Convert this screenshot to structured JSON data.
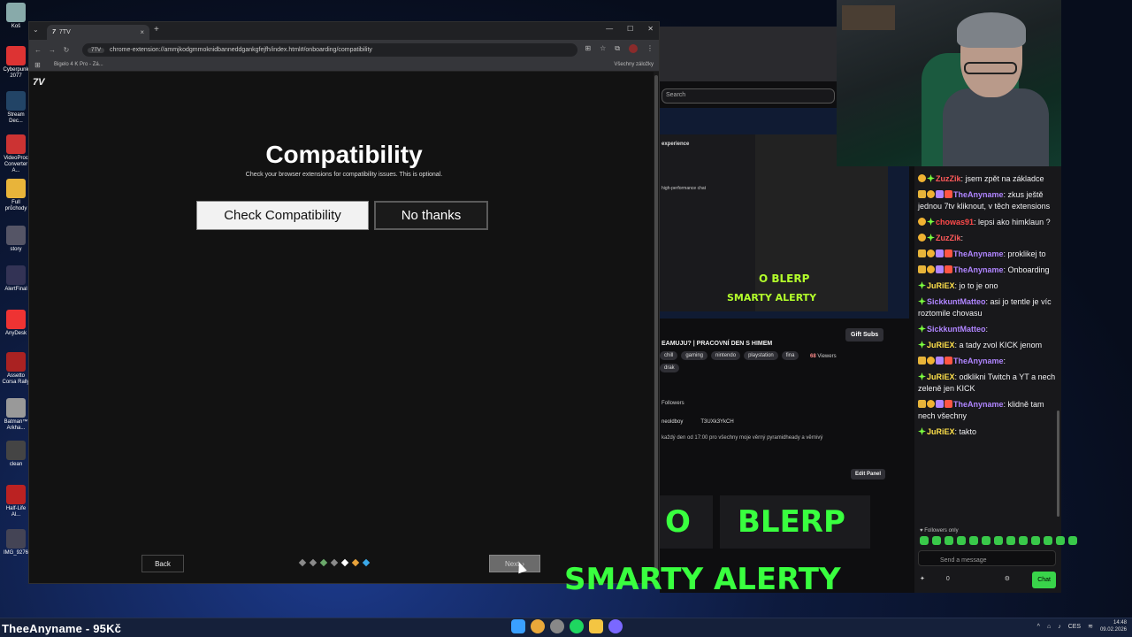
{
  "desktop": {
    "icons": [
      {
        "label": "Koš"
      },
      {
        "label": "Cyberpunk 2077"
      },
      {
        "label": "Stream Dec..."
      },
      {
        "label": "VideoProc Converter A..."
      },
      {
        "label": "Full průchody"
      },
      {
        "label": "story"
      },
      {
        "label": "AlertFinal"
      },
      {
        "label": "AnyDesk"
      },
      {
        "label": "Assetto Corsa Rally"
      },
      {
        "label": "Batman™ Arkha..."
      },
      {
        "label": "clean"
      },
      {
        "label": "Half-Life Al..."
      },
      {
        "label": "IMG_9276"
      }
    ]
  },
  "browser": {
    "tab_title": "7TV",
    "url_chip": "7TV",
    "url": "chrome-extension://ammjkodgmmoknidbanneddgankgfejfh/index.html#/onboarding/compatibility",
    "bookmark": "Bigelo 4 K Pro - Zá...",
    "bookmarks_right": "Všechny záložky"
  },
  "onboarding": {
    "title": "Compatibility",
    "subtitle": "Check your browser extensions for compatibility issues. This is optional.",
    "check_label": "Check Compatibility",
    "nothanks_label": "No thanks",
    "back_label": "Back",
    "next_label": "Next",
    "step_colors": [
      "#8a8a8a",
      "#8a8a8a",
      "#6aa86a",
      "#8a8a8a",
      "#ffffff",
      "#e8a23a",
      "#3aa8e8"
    ]
  },
  "twitch": {
    "search_placeholder": "Search",
    "video_text1": "experience",
    "video_text2": "high-performance chat",
    "video_blerp": "O   BLERP",
    "video_alerty": "SMARTY ALERTY",
    "stream_title": "EAMUJU? | PRACOVNÍ DEN S HIMEM",
    "tags": [
      "chill",
      "gaming",
      "nintendo",
      "playstation",
      "fina",
      "drak"
    ],
    "gift_subs": "Gift Subs",
    "viewers": "68",
    "viewers_label": "Viewers",
    "followers": "Followers",
    "link1": "neoldboy",
    "link2": "T3UXk3YkCH",
    "description": "každý den od 17:00 pro všechny moje věrný pyramidheady a věrnivý",
    "edit_panel": "Edit Panel",
    "panel_o": "O",
    "panel_blerp": "BLERP",
    "panel_alerty": "SMARTY ALERTY"
  },
  "chat": {
    "messages": [
      {
        "user": "ZuzZik",
        "color": "#ff5a5a",
        "badges": [
          "gold",
          "green"
        ],
        "text": "jsem zpět na základce"
      },
      {
        "user": "TheAnyname",
        "color": "#b085ff",
        "badges": [
          "crown",
          "gold",
          "purple",
          "red"
        ],
        "text": "zkus ještě jednou 7tv kliknout, v těch extensions"
      },
      {
        "user": "chowas91",
        "color": "#ff4a4a",
        "badges": [
          "gold",
          "green"
        ],
        "text": "lepsi ako himklaun ?"
      },
      {
        "user": "ZuzZik",
        "color": "#ff5a5a",
        "badges": [
          "gold",
          "green"
        ],
        "text": ""
      },
      {
        "user": "TheAnyname",
        "color": "#b085ff",
        "badges": [
          "crown",
          "gold",
          "purple",
          "red"
        ],
        "text": "proklikej to"
      },
      {
        "user": "TheAnyname",
        "color": "#b085ff",
        "badges": [
          "crown",
          "gold",
          "purple",
          "red"
        ],
        "text": "Onboarding"
      },
      {
        "user": "JuRiEX",
        "color": "#ffe14a",
        "badges": [
          "green"
        ],
        "text": "jo to je ono"
      },
      {
        "user": "SickkuntMatteo",
        "color": "#b085ff",
        "badges": [
          "green"
        ],
        "text": "asi jo tentle je víc roztomile chovasu"
      },
      {
        "user": "SickkuntMatteo",
        "color": "#b085ff",
        "badges": [
          "green"
        ],
        "text": ""
      },
      {
        "user": "JuRiEX",
        "color": "#ffe14a",
        "badges": [
          "green"
        ],
        "text": "a tady zvol KICK jenom"
      },
      {
        "user": "TheAnyname",
        "color": "#b085ff",
        "badges": [
          "crown",
          "gold",
          "purple",
          "red"
        ],
        "text": ""
      },
      {
        "user": "JuRiEX",
        "color": "#ffe14a",
        "badges": [
          "green"
        ],
        "text": "odklikni Twitch a YT a nech zeleně jen KICK"
      },
      {
        "user": "TheAnyname",
        "color": "#b085ff",
        "badges": [
          "crown",
          "gold",
          "purple",
          "red"
        ],
        "text": "klidně tam nech všechny"
      },
      {
        "user": "JuRiEX",
        "color": "#ffe14a",
        "badges": [
          "green"
        ],
        "text": "takto"
      }
    ],
    "followers_only": "Followers only",
    "input_placeholder": "Send a message",
    "points": "0",
    "chat_button": "Chat"
  },
  "taskbar": {
    "overlay_name": "TheeAnyname - 95Kč",
    "lang": "CES",
    "time": "14:48",
    "date": "09.02.2026"
  }
}
